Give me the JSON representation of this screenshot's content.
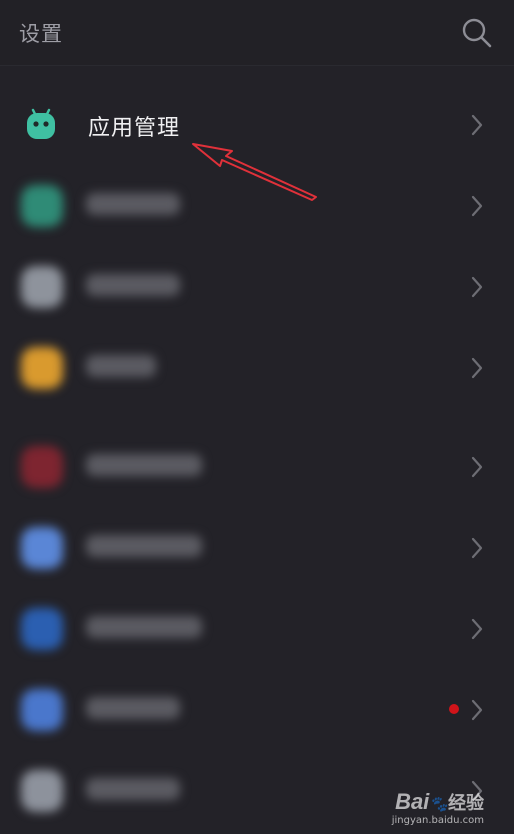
{
  "header": {
    "title": "设置",
    "search_icon": "search-icon"
  },
  "settings_list": {
    "highlighted_item": {
      "label": "应用管理",
      "icon": "android-robot-icon",
      "icon_color": "#3fc0a2"
    },
    "blurred_item_icon_colors": [
      "#2f8b76",
      "#8e939c",
      "#d99a2e",
      "#7e2530",
      "#5a86d6",
      "#2b5fb1",
      "#4a77cc",
      "#8d929c"
    ],
    "notification_dot_color": "#d0141a"
  },
  "annotation": {
    "arrow_color": "#e0313a"
  },
  "watermark": {
    "brand": "Bai",
    "brand_suffix": "经验",
    "url": "jingyan.baidu.com"
  }
}
